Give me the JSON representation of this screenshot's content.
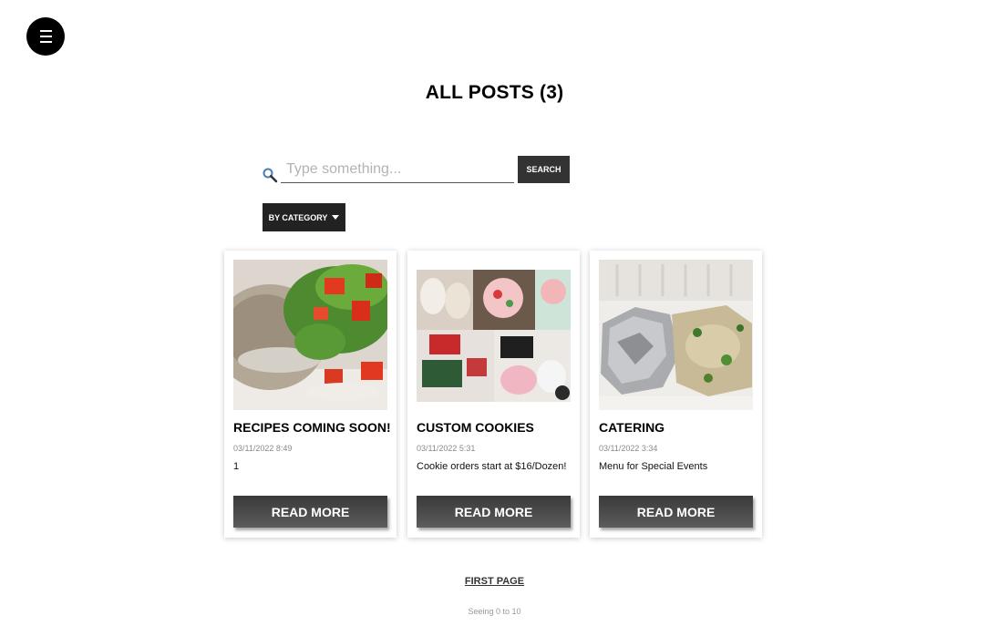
{
  "header": {
    "menu_icon": "hamburger-icon"
  },
  "page": {
    "title": "ALL POSTS (3)"
  },
  "search": {
    "placeholder": "Type something...",
    "button_label": "SEARCH",
    "icon": "search-icon"
  },
  "filter": {
    "category_label": "BY CATEGORY",
    "icon": "caret-down-icon"
  },
  "posts": [
    {
      "title": "RECIPES COMING SOON!",
      "date": "03/11/2022 8:49",
      "description": "1",
      "button_label": "READ MORE"
    },
    {
      "title": "CUSTOM COOKIES",
      "date": "03/11/2022 5:31",
      "description": "Cookie orders start at $16/Dozen!",
      "button_label": "READ MORE"
    },
    {
      "title": "CATERING",
      "date": "03/11/2022 3:34",
      "description": "Menu for Special Events",
      "button_label": "READ MORE"
    }
  ],
  "pagination": {
    "first_page_label": "FIRST PAGE",
    "status": "Seeing 0 to 10"
  },
  "colors": {
    "button_dark": "#333333",
    "category_button": "#222222",
    "read_more_gradient_top": "#3a3a3a",
    "read_more_gradient_bottom": "#5c5c5c"
  }
}
